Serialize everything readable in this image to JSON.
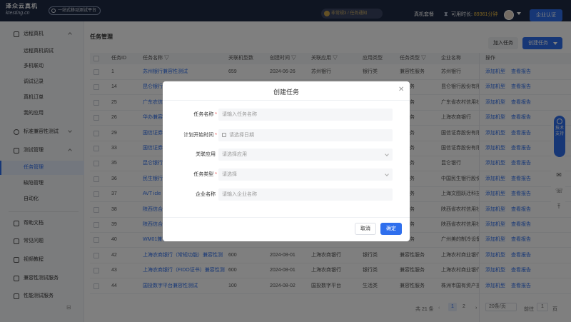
{
  "topbar": {
    "logo_line1": "泽众云真机",
    "logo_line2": "ktesting.cn",
    "platform_tag": "一站式移动测试平台",
    "notice": "非常规3 / 任务通知",
    "real_device_package": "真机套餐",
    "duration_label": "可用时长:",
    "duration_value": "89361分钟",
    "enterprise_btn": "企业认证"
  },
  "sidebar": {
    "groups": [
      {
        "label": "远程真机",
        "icon": "phone-icon",
        "children": [
          "远程真机调试",
          "多机联动",
          "调试记录",
          "真机订单",
          "我的应用"
        ]
      },
      {
        "label": "标准兼容性测试",
        "icon": "compat-icon"
      },
      {
        "label": "测试管理",
        "icon": "flask-icon",
        "children": [
          "任务管理",
          "缺陷管理",
          "自动化"
        ]
      }
    ],
    "bottom": [
      {
        "label": "帮助文档",
        "icon": "doc-icon"
      },
      {
        "label": "常见问题",
        "icon": "question-icon"
      },
      {
        "label": "视频教程",
        "icon": "video-icon"
      },
      {
        "label": "兼容性测试服务",
        "icon": "service-icon"
      },
      {
        "label": "性能测试服务",
        "icon": "perf-icon"
      }
    ],
    "active_item": "任务管理"
  },
  "main": {
    "title": "任务管理",
    "join_btn": "加入任务",
    "create_btn": "创建任务",
    "headers": [
      "任务ID",
      "任务名称",
      "关联机型数",
      "创建时间",
      "关联应用",
      "应用类型",
      "任务类型",
      "企业名称",
      "操作"
    ],
    "rows": [
      {
        "id": "1",
        "name": "苏州银行兼容性测试",
        "count": "659",
        "date": "2024-06-26",
        "app": "苏州银行",
        "app_type": "银行类",
        "task_type": "兼容性服务",
        "company": "苏州银行"
      },
      {
        "id": "14",
        "name": "昆仑银行",
        "count": "",
        "date": "",
        "app": "",
        "app_type": "",
        "task_type": "性服务",
        "company": "昆仑银行股份有限公司"
      },
      {
        "id": "25",
        "name": "广东农信",
        "count": "",
        "date": "",
        "app": "",
        "app_type": "",
        "task_type": "性服务",
        "company": "广东省农村信用社"
      },
      {
        "id": "26",
        "name": "华办兼容",
        "count": "",
        "date": "",
        "app": "",
        "app_type": "",
        "task_type": "性服务",
        "company": "上海农商银行"
      },
      {
        "id": "29",
        "name": "国信证券",
        "count": "",
        "date": "",
        "app": "",
        "app_type": "",
        "task_type": "性服务",
        "company": "国信证券股份有限公司"
      },
      {
        "id": "33",
        "name": "国信证券",
        "count": "",
        "date": "",
        "app": "",
        "app_type": "",
        "task_type": "性服务",
        "company": "国信证券股份有限公司"
      },
      {
        "id": "35",
        "name": "昆仑银行",
        "count": "",
        "date": "",
        "app": "",
        "app_type": "",
        "task_type": "性服务",
        "company": "昆仑银行"
      },
      {
        "id": "36",
        "name": "民生银行",
        "count": "",
        "date": "",
        "app": "",
        "app_type": "",
        "task_type": "性服务",
        "company": "中国民生银行股份有限"
      },
      {
        "id": "37",
        "name": "AVT icle",
        "count": "",
        "date": "",
        "app": "",
        "app_type": "",
        "task_type": "性服务",
        "company": "上海文图跃迁科技有限"
      },
      {
        "id": "38",
        "name": "陕西信合",
        "count": "",
        "date": "",
        "app": "",
        "app_type": "",
        "task_type": "性服务",
        "company": "陕西省农村信用社联合"
      },
      {
        "id": "39",
        "name": "陕西信合",
        "count": "",
        "date": "",
        "app": "",
        "app_type": "",
        "task_type": "性服务",
        "company": "陕西省农村信用社联合"
      },
      {
        "id": "40",
        "name": "WM01兼容性测试",
        "count": "",
        "date": "",
        "app": "",
        "app_type": "",
        "task_type": "性服务",
        "company": "广州美的制冷设备有限"
      },
      {
        "id": "42",
        "name": "上海农商银行（常规功能）兼容性测",
        "count": "600",
        "date": "2024-08-01",
        "app": "上海农商银行",
        "app_type": "银行类",
        "task_type": "兼容性服务",
        "company": "上海农村商业银行"
      },
      {
        "id": "43",
        "name": "上海农商银行（FIDO证书）兼容性测",
        "count": "600",
        "date": "2024-08-01",
        "app": "上海农商银行",
        "app_type": "银行类",
        "task_type": "兼容性服务",
        "company": "上海农村商业银行"
      },
      {
        "id": "44",
        "name": "国投数字平台兼容性测试",
        "count": "100",
        "date": "2024-08-02",
        "app": "国投数字平台",
        "app_type": "生活类",
        "task_type": "兼容性服务",
        "company": "株洲市国有资产投资控"
      }
    ],
    "op_add": "添加机型",
    "op_report": "查看报告",
    "pager": {
      "total": "共 21 条",
      "pages": [
        "1",
        "2"
      ],
      "size": "20条/页",
      "goto": "前往",
      "page_input": "1",
      "page_suffix": "页"
    }
  },
  "modal": {
    "title": "创建任务",
    "fields": [
      {
        "label": "任务名称",
        "required": "*",
        "placeholder": "请输入任务名称"
      },
      {
        "label": "计划开始时间",
        "required": "*",
        "placeholder": "请选择日期"
      },
      {
        "label": "关联应用",
        "required": "",
        "placeholder": "请选择应用"
      },
      {
        "label": "任务类型",
        "required": "*",
        "placeholder": "请选择"
      },
      {
        "label": "企业名称",
        "required": "",
        "placeholder": "请输入企业名称"
      }
    ],
    "cancel": "取消",
    "confirm": "确定"
  },
  "floatbar": {
    "support": "技术支持"
  }
}
